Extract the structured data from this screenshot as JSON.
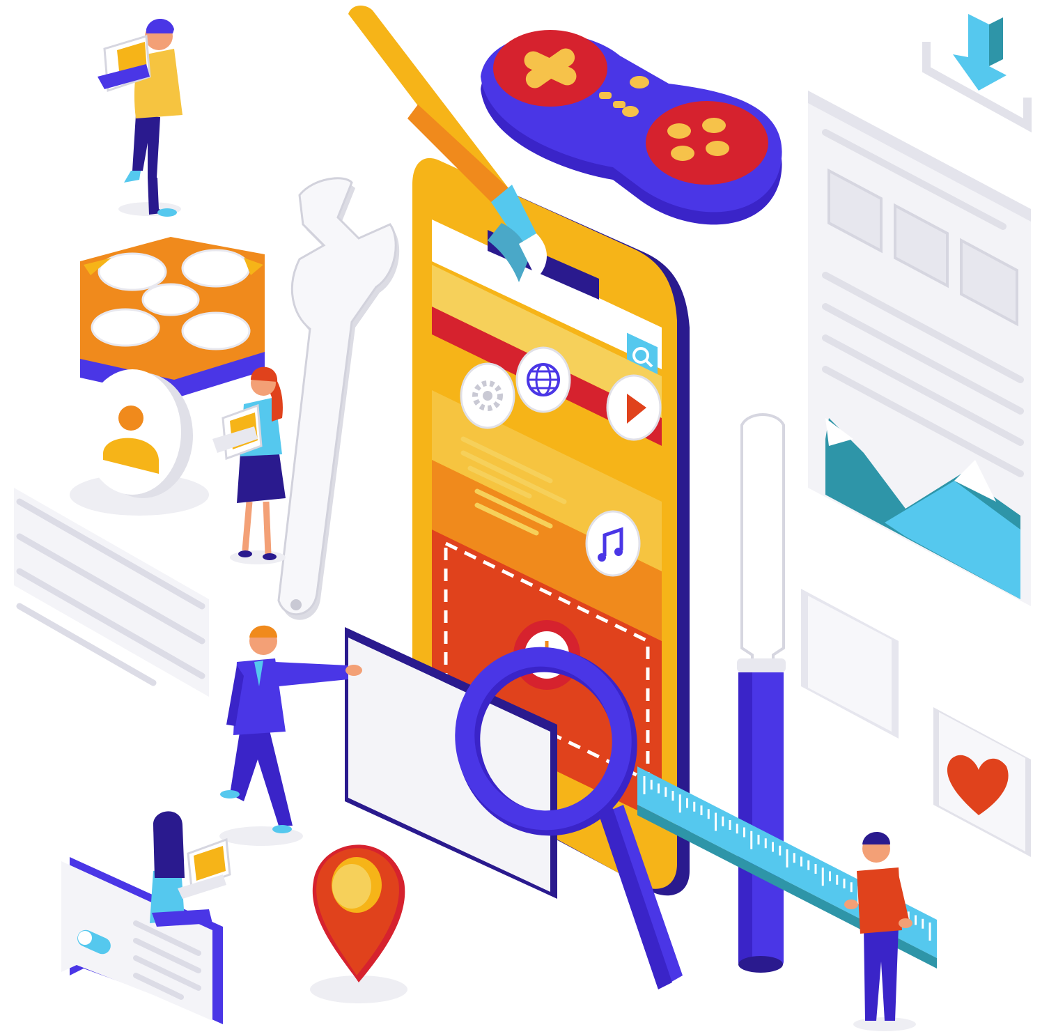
{
  "illustration": {
    "subject": "isometric-mobile-app-development",
    "has_visible_text": false
  },
  "icons": {
    "settings": "gear-icon",
    "web": "globe-icon",
    "media": "play-icon",
    "audio": "music-note-icon",
    "search": "search-icon",
    "profile": "user-icon",
    "favorite": "heart-icon",
    "location": "map-pin-icon",
    "download": "download-arrow-icon",
    "gaming": "gamepad-icon",
    "tools": [
      "wrench-icon",
      "screwdriver-icon",
      "paintbrush-icon",
      "magnifier-icon",
      "ruler-icon"
    ]
  },
  "palette": {
    "primary_violet": "#4a36e6",
    "amber": "#f6b418",
    "orange": "#f08a1c",
    "red_orange": "#e0421c",
    "crimson": "#d6222e",
    "sky_blue": "#55c8ee",
    "teal": "#2e95a8",
    "light_gray": "#e6e6ee",
    "white": "#ffffff"
  }
}
